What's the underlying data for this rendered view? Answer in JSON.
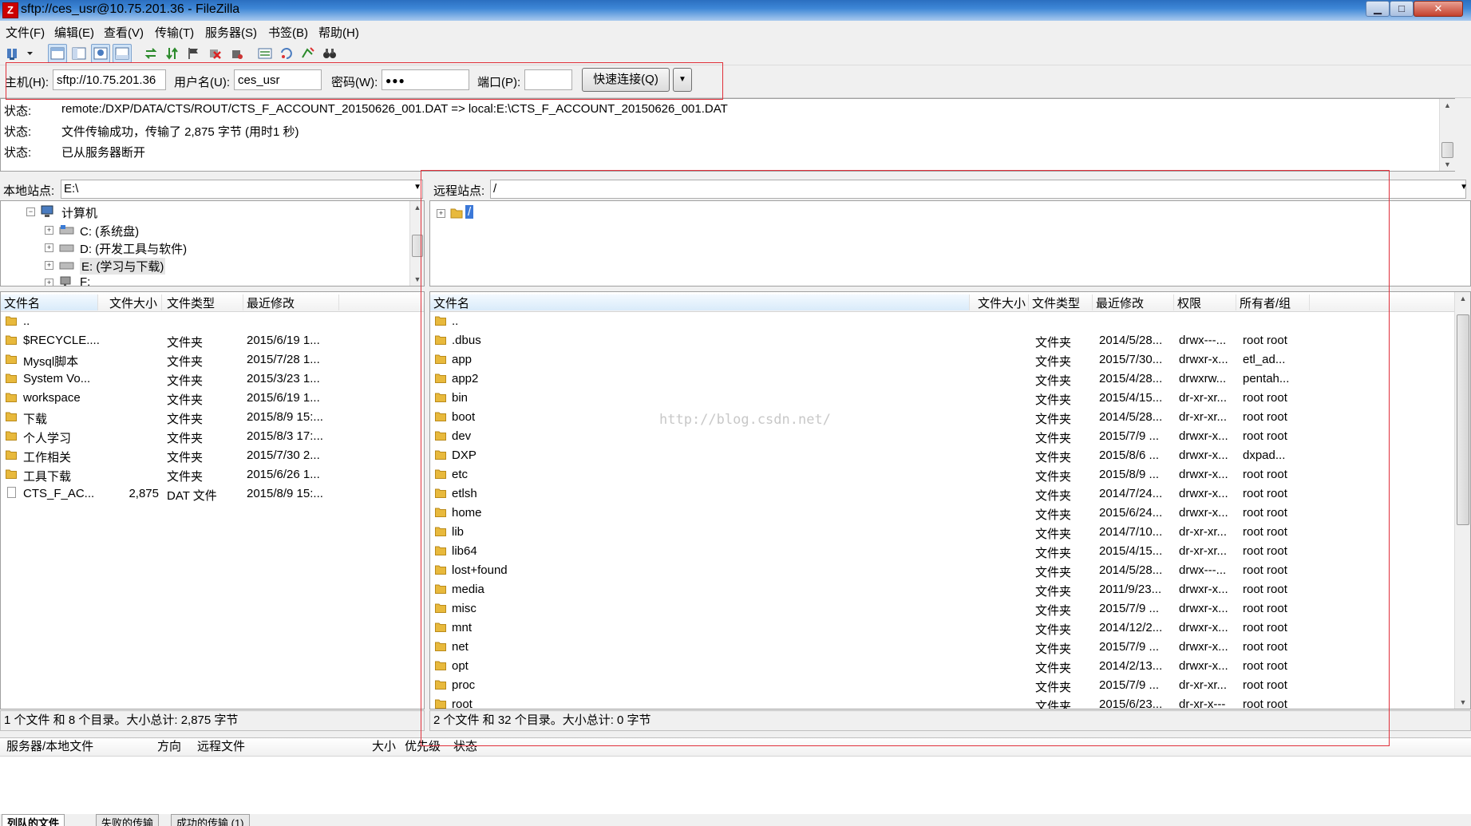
{
  "window": {
    "title": "sftp://ces_usr@10.75.201.36 - FileZilla",
    "app_icon": "Z"
  },
  "menu": [
    "文件(F)",
    "编辑(E)",
    "查看(V)",
    "传输(T)",
    "服务器(S)",
    "书签(B)",
    "帮助(H)"
  ],
  "quickconnect": {
    "host_label": "主机(H):",
    "host_value": "sftp://10.75.201.36",
    "user_label": "用户名(U):",
    "user_value": "ces_usr",
    "pass_label": "密码(W):",
    "pass_value": "●●●",
    "port_label": "端口(P):",
    "port_value": "",
    "button_label": "快速连接(Q)"
  },
  "log": [
    {
      "label": "状态:",
      "text": "remote:/DXP/DATA/CTS/ROUT/CTS_F_ACCOUNT_20150626_001.DAT => local:E:\\CTS_F_ACCOUNT_20150626_001.DAT"
    },
    {
      "label": "状态:",
      "text": "文件传输成功，传输了 2,875 字节 (用时1 秒)"
    },
    {
      "label": "状态:",
      "text": "已从服务器断开"
    }
  ],
  "local": {
    "site_label": "本地站点:",
    "path": "E:\\",
    "tree": [
      {
        "label": "计算机"
      },
      {
        "label": "C: (系统盘)"
      },
      {
        "label": "D: (开发工具与软件)"
      },
      {
        "label": "E: (学习与下载)"
      },
      {
        "label": "F:"
      }
    ],
    "columns": [
      "文件名",
      "文件大小",
      "文件类型",
      "最近修改"
    ],
    "rows": [
      {
        "name": "..",
        "size": "",
        "type": "",
        "modified": "",
        "kind": "folder"
      },
      {
        "name": "$RECYCLE....",
        "size": "",
        "type": "文件夹",
        "modified": "2015/6/19 1...",
        "kind": "folder"
      },
      {
        "name": "Mysql脚本",
        "size": "",
        "type": "文件夹",
        "modified": "2015/7/28 1...",
        "kind": "folder"
      },
      {
        "name": "System Vo...",
        "size": "",
        "type": "文件夹",
        "modified": "2015/3/23 1...",
        "kind": "folder"
      },
      {
        "name": "workspace",
        "size": "",
        "type": "文件夹",
        "modified": "2015/6/19 1...",
        "kind": "folder"
      },
      {
        "name": "下载",
        "size": "",
        "type": "文件夹",
        "modified": "2015/8/9 15:...",
        "kind": "folder"
      },
      {
        "name": "个人学习",
        "size": "",
        "type": "文件夹",
        "modified": "2015/8/3 17:...",
        "kind": "folder"
      },
      {
        "name": "工作相关",
        "size": "",
        "type": "文件夹",
        "modified": "2015/7/30 2...",
        "kind": "folder"
      },
      {
        "name": "工具下载",
        "size": "",
        "type": "文件夹",
        "modified": "2015/6/26 1...",
        "kind": "folder"
      },
      {
        "name": "CTS_F_AC...",
        "size": "2,875",
        "type": "DAT 文件",
        "modified": "2015/8/9 15:...",
        "kind": "file"
      }
    ],
    "status": "1 个文件 和 8 个目录。大小总计: 2,875 字节"
  },
  "remote": {
    "site_label": "远程站点:",
    "path": "/",
    "tree_root": "/",
    "columns": [
      "文件名",
      "文件大小",
      "文件类型",
      "最近修改",
      "权限",
      "所有者/组"
    ],
    "rows": [
      {
        "name": "..",
        "type": "",
        "modified": "",
        "perm": "",
        "owner": ""
      },
      {
        "name": ".dbus",
        "type": "文件夹",
        "modified": "2014/5/28...",
        "perm": "drwx---...",
        "owner": "root root"
      },
      {
        "name": "app",
        "type": "文件夹",
        "modified": "2015/7/30...",
        "perm": "drwxr-x...",
        "owner": "etl_ad..."
      },
      {
        "name": "app2",
        "type": "文件夹",
        "modified": "2015/4/28...",
        "perm": "drwxrw...",
        "owner": "pentah..."
      },
      {
        "name": "bin",
        "type": "文件夹",
        "modified": "2015/4/15...",
        "perm": "dr-xr-xr...",
        "owner": "root root"
      },
      {
        "name": "boot",
        "type": "文件夹",
        "modified": "2014/5/28...",
        "perm": "dr-xr-xr...",
        "owner": "root root"
      },
      {
        "name": "dev",
        "type": "文件夹",
        "modified": "2015/7/9 ...",
        "perm": "drwxr-x...",
        "owner": "root root"
      },
      {
        "name": "DXP",
        "type": "文件夹",
        "modified": "2015/8/6 ...",
        "perm": "drwxr-x...",
        "owner": "dxpad..."
      },
      {
        "name": "etc",
        "type": "文件夹",
        "modified": "2015/8/9 ...",
        "perm": "drwxr-x...",
        "owner": "root root"
      },
      {
        "name": "etlsh",
        "type": "文件夹",
        "modified": "2014/7/24...",
        "perm": "drwxr-x...",
        "owner": "root root"
      },
      {
        "name": "home",
        "type": "文件夹",
        "modified": "2015/6/24...",
        "perm": "drwxr-x...",
        "owner": "root root"
      },
      {
        "name": "lib",
        "type": "文件夹",
        "modified": "2014/7/10...",
        "perm": "dr-xr-xr...",
        "owner": "root root"
      },
      {
        "name": "lib64",
        "type": "文件夹",
        "modified": "2015/4/15...",
        "perm": "dr-xr-xr...",
        "owner": "root root"
      },
      {
        "name": "lost+found",
        "type": "文件夹",
        "modified": "2014/5/28...",
        "perm": "drwx---...",
        "owner": "root root"
      },
      {
        "name": "media",
        "type": "文件夹",
        "modified": "2011/9/23...",
        "perm": "drwxr-x...",
        "owner": "root root"
      },
      {
        "name": "misc",
        "type": "文件夹",
        "modified": "2015/7/9 ...",
        "perm": "drwxr-x...",
        "owner": "root root"
      },
      {
        "name": "mnt",
        "type": "文件夹",
        "modified": "2014/12/2...",
        "perm": "drwxr-x...",
        "owner": "root root"
      },
      {
        "name": "net",
        "type": "文件夹",
        "modified": "2015/7/9 ...",
        "perm": "drwxr-x...",
        "owner": "root root"
      },
      {
        "name": "opt",
        "type": "文件夹",
        "modified": "2014/2/13...",
        "perm": "drwxr-x...",
        "owner": "root root"
      },
      {
        "name": "proc",
        "type": "文件夹",
        "modified": "2015/7/9 ...",
        "perm": "dr-xr-xr...",
        "owner": "root root"
      },
      {
        "name": "root",
        "type": "文件夹",
        "modified": "2015/6/23...",
        "perm": "dr-xr-x---",
        "owner": "root root"
      }
    ],
    "status": "2 个文件 和 32 个目录。大小总计: 0 字节"
  },
  "queue": {
    "columns": [
      "服务器/本地文件",
      "方向",
      "远程文件",
      "大小",
      "优先级",
      "状态"
    ],
    "tabs": [
      "列队的文件",
      "失败的传输",
      "成功的传输 (1)"
    ]
  },
  "watermark": "http://blog.csdn.net/",
  "colors": {
    "annotation_red": "#e0303a",
    "folder": "#e8b93c",
    "title_blue": "#3d86d6"
  }
}
